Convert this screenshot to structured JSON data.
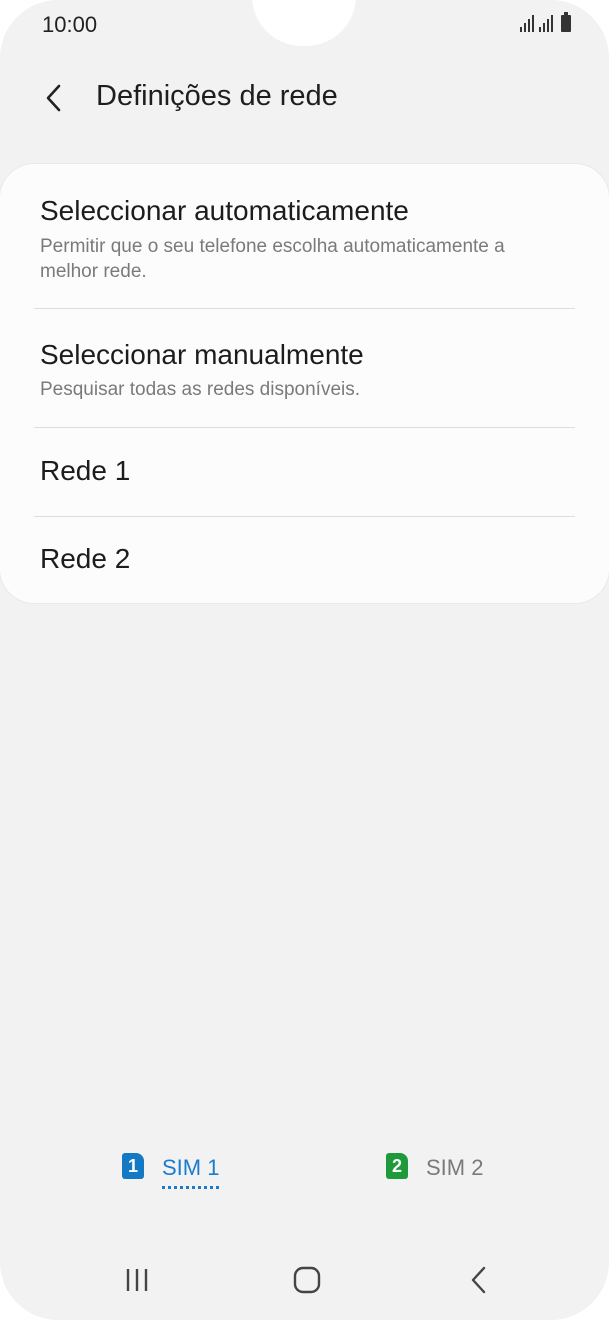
{
  "status_bar": {
    "time": "10:00",
    "icons": [
      "signal-sim1-icon",
      "signal-sim2-icon",
      "battery-icon"
    ]
  },
  "header": {
    "back_icon": "chevron-left-icon",
    "title": "Definições de rede"
  },
  "network_options": [
    {
      "title": "Seleccionar automaticamente",
      "subtitle": "Permitir que o seu telefone escolha automaticamente a melhor rede."
    },
    {
      "title": "Seleccionar manualmente",
      "subtitle": "Pesquisar todas as redes disponíveis."
    },
    {
      "title": "Rede 1"
    },
    {
      "title": "Rede 2"
    }
  ],
  "sim_tabs": [
    {
      "badge": "1",
      "label": "SIM 1",
      "selected": true,
      "color": "#1479c4"
    },
    {
      "badge": "2",
      "label": "SIM 2",
      "selected": false,
      "color": "#1f9a3a"
    }
  ],
  "nav_bar": {
    "icons": [
      "recents-icon",
      "home-icon",
      "back-icon"
    ]
  },
  "colors": {
    "background": "#f2f2f2",
    "card": "#fcfcfc",
    "accent": "#1a7ccf"
  }
}
